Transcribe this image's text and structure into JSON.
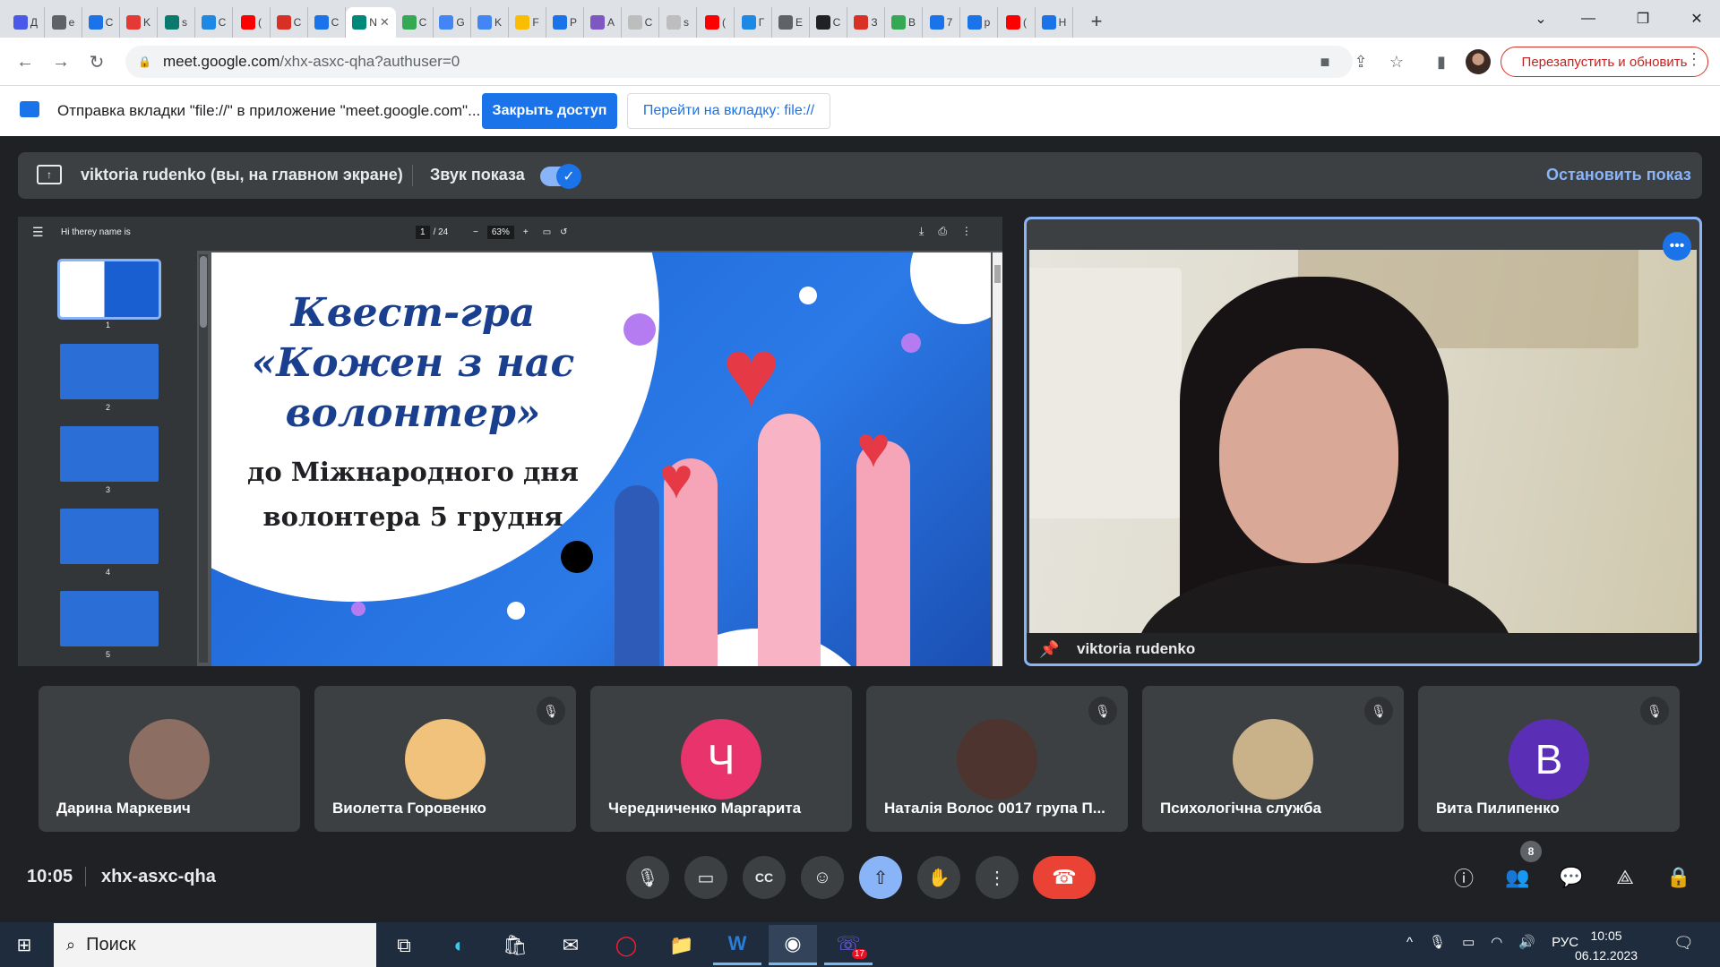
{
  "browser": {
    "tabs": [
      {
        "letter": "Д",
        "color": "#4a5ae8"
      },
      {
        "letter": "e",
        "color": "#5f6368"
      },
      {
        "letter": "С",
        "color": "#1a73e8"
      },
      {
        "letter": "K",
        "color": "#e53935"
      },
      {
        "letter": "s",
        "color": "#0b7a6c"
      },
      {
        "letter": "С",
        "color": "#1e88e5"
      },
      {
        "letter": "(",
        "color": "#ff0000"
      },
      {
        "letter": "С",
        "color": "#d93025"
      },
      {
        "letter": "С",
        "color": "#1a73e8"
      },
      {
        "letter": "N",
        "color": "#00897b",
        "active": true
      },
      {
        "letter": "С",
        "color": "#34a853"
      },
      {
        "letter": "G",
        "color": "#4285f4"
      },
      {
        "letter": "K",
        "color": "#4285f4"
      },
      {
        "letter": "F",
        "color": "#fbbc04"
      },
      {
        "letter": "P",
        "color": "#1a73e8"
      },
      {
        "letter": "A",
        "color": "#7e57c2"
      },
      {
        "letter": "С",
        "color": "#bdbdbd"
      },
      {
        "letter": "s",
        "color": "#bdbdbd"
      },
      {
        "letter": "(",
        "color": "#ff0000"
      },
      {
        "letter": "Г",
        "color": "#1e88e5"
      },
      {
        "letter": "E",
        "color": "#5f6368"
      },
      {
        "letter": "С",
        "color": "#202124"
      },
      {
        "letter": "З",
        "color": "#d93025"
      },
      {
        "letter": "В",
        "color": "#34a853"
      },
      {
        "letter": "7",
        "color": "#1a73e8"
      },
      {
        "letter": "р",
        "color": "#1a73e8"
      },
      {
        "letter": "(",
        "color": "#ff0000"
      },
      {
        "letter": "Н",
        "color": "#1a73e8"
      }
    ],
    "active_tab_close": "✕",
    "new_tab": "+",
    "url_host": "meet.google.com",
    "url_path": "/xhx-asxc-qha?authuser=0",
    "restart_label": "Перезапустить и обновить"
  },
  "infobar": {
    "text": "Отправка вкладки \"file://\" в приложение \"meet.google.com\"...",
    "stop_access": "Закрыть доступ",
    "goto_tab": "Перейти на вкладку: file://"
  },
  "present_bar": {
    "presenter": "viktoria rudenko (вы, на главном экране)",
    "sound_label": "Звук показа",
    "sound_on": true,
    "stop_label": "Остановить показ"
  },
  "pdf": {
    "title": "Hi therey name is",
    "page": "1",
    "page_total": "/ 24",
    "zoom": "63%",
    "thumbs": [
      "1",
      "2",
      "3",
      "4",
      "5"
    ],
    "slide_title": "Квест-гра «Кожен з нас волонтер»",
    "slide_subtitle": "до Міжнародного дня волонтера 5 грудня"
  },
  "camera": {
    "name": "viktoria rudenko"
  },
  "participants": [
    {
      "name": "Дарина Маркевич",
      "initial": "",
      "color": "#8d6e63",
      "muted": false
    },
    {
      "name": "Виолетта Горовенко",
      "initial": "",
      "color": "#f0c27b",
      "muted": true
    },
    {
      "name": "Чередниченко Маргарита",
      "initial": "Ч",
      "color": "#e8336d",
      "muted": false
    },
    {
      "name": "Наталія Волос 0017 група П...",
      "initial": "",
      "color": "#4e342e",
      "muted": true
    },
    {
      "name": "Психологічна служба",
      "initial": "",
      "color": "#c9b18a",
      "muted": true
    },
    {
      "name": "Вита Пилипенко",
      "initial": "В",
      "color": "#5b2fb5",
      "muted": true
    }
  ],
  "meeting": {
    "time": "10:05",
    "code": "xhx-asxc-qha",
    "people_count": "8"
  },
  "taskbar": {
    "search_placeholder": "Поиск",
    "lang": "РУС",
    "time": "10:05",
    "date": "06.12.2023",
    "viber_badge": "17"
  }
}
